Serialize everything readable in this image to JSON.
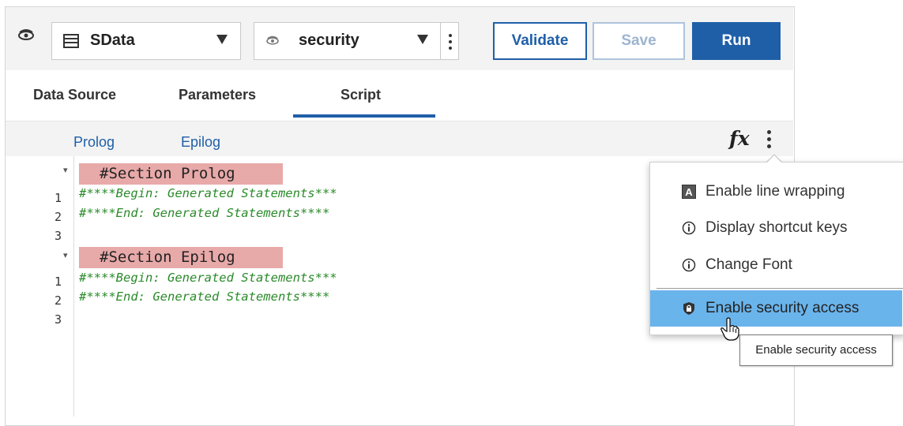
{
  "toolbar": {
    "datasource_dropdown": "SData",
    "security_dropdown": "security",
    "validate_label": "Validate",
    "save_label": "Save",
    "run_label": "Run"
  },
  "tabs": [
    {
      "label": "Data Source",
      "active": false
    },
    {
      "label": "Parameters",
      "active": false
    },
    {
      "label": "Script",
      "active": true
    }
  ],
  "subtabs": [
    {
      "label": "Prolog"
    },
    {
      "label": "Epilog"
    }
  ],
  "function_label": "fx",
  "editor": {
    "prolog": {
      "header": "#Section Prolog",
      "lines": [
        {
          "num": "1",
          "text": "#****Begin: Generated Statements***"
        },
        {
          "num": "2",
          "text": "#****End: Generated Statements****"
        },
        {
          "num": "3",
          "text": ""
        }
      ]
    },
    "epilog": {
      "header": "#Section Epilog",
      "lines": [
        {
          "num": "1",
          "text": "#****Begin: Generated Statements***"
        },
        {
          "num": "2",
          "text": "#****End: Generated Statements****"
        },
        {
          "num": "3",
          "text": ""
        }
      ]
    }
  },
  "menu": {
    "items": [
      {
        "label": "Enable line wrapping",
        "icon": "text-wrap-icon"
      },
      {
        "label": "Display shortcut keys",
        "icon": "info-icon"
      },
      {
        "label": "Change Font",
        "icon": "info-icon"
      },
      {
        "label": "Enable security access",
        "icon": "lock-icon",
        "highlighted": true
      }
    ]
  },
  "tooltip": "Enable security access",
  "colors": {
    "primary": "#1f5fa8",
    "highlight": "#6ab4ec",
    "section_bg": "#e8a9a9",
    "comment_green": "#2a8a2a"
  }
}
